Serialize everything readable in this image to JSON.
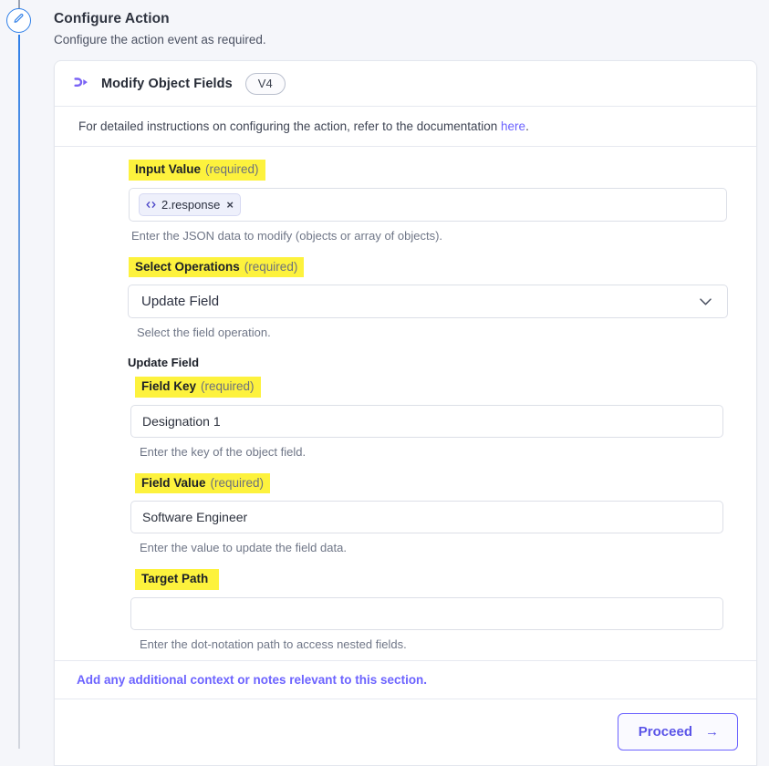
{
  "rail": {
    "node_icon": "pencil-icon"
  },
  "header": {
    "title": "Configure Action",
    "subtitle": "Configure the action event as required."
  },
  "card": {
    "action_icon": "flow-branch-icon",
    "action_title": "Modify Object Fields",
    "version_badge": "V4",
    "doc_text_before": "For detailed instructions on configuring the action, refer to the documentation ",
    "doc_link_label": "here",
    "doc_text_after": "."
  },
  "fields": {
    "input_value": {
      "label": "Input Value",
      "required_note": "(required)",
      "chip_icon": "code-icon",
      "chip_label": "2.response",
      "chip_remove": "×",
      "helper": "Enter the JSON data to modify (objects or array of objects)."
    },
    "select_operations": {
      "label": "Select Operations",
      "required_note": "(required)",
      "value": "Update Field",
      "helper": "Select the field operation.",
      "chevron_icon": "chevron-down-icon"
    },
    "update_field_group": "Update Field",
    "field_key": {
      "label": "Field Key",
      "required_note": "(required)",
      "value": "Designation 1",
      "placeholder": "",
      "helper": "Enter the key of the object field."
    },
    "field_value": {
      "label": "Field Value",
      "required_note": "(required)",
      "value": "Software Engineer",
      "placeholder": "",
      "helper": "Enter the value to update the field data."
    },
    "target_path": {
      "label": "Target Path",
      "required_note": "",
      "value": "",
      "placeholder": "",
      "helper": "Enter the dot-notation path to access nested fields."
    }
  },
  "notes": {
    "label": "Add any additional context or notes relevant to this section."
  },
  "footer": {
    "proceed_label": "Proceed",
    "proceed_arrow": "→"
  },
  "colors": {
    "page_bg": "#f5f6fa",
    "accent_purple": "#6c63ff",
    "highlight_yellow": "#fdf23d",
    "rail_blue": "#2f7fe8",
    "text_primary": "#2c313d"
  }
}
